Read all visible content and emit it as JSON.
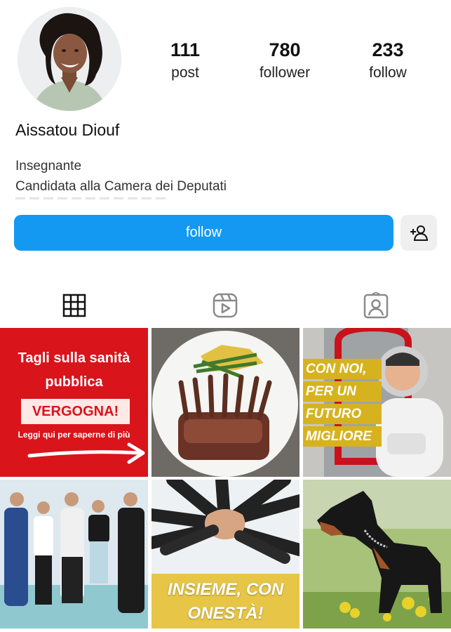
{
  "profile": {
    "name": "Aissatou Diouf",
    "bio_line1": "Insegnante",
    "bio_line2": "Candidata alla Camera dei Deputati"
  },
  "stats": {
    "posts": {
      "value": "111",
      "label": "post"
    },
    "followers": {
      "value": "780",
      "label": "follower"
    },
    "following": {
      "value": "233",
      "label": "follow"
    }
  },
  "actions": {
    "follow_label": "follow",
    "add_icon": "person-add-icon"
  },
  "tabs": [
    {
      "name": "grid",
      "icon": "grid-icon",
      "active": true
    },
    {
      "name": "reels",
      "icon": "reels-icon"
    },
    {
      "name": "tagged",
      "icon": "tagged-icon"
    }
  ],
  "posts": [
    {
      "type": "graphic",
      "line1": "Tagli sulla sanità",
      "line2": "pubblica",
      "highlight": "VERGOGNA!",
      "cta": "Leggi qui per saperne di più"
    },
    {
      "type": "photo",
      "subject": "food-plate"
    },
    {
      "type": "photo-with-text",
      "line1": "CON NOI,",
      "line2": "PER UN",
      "line3": "FUTURO",
      "line4": "MIGLIORE"
    },
    {
      "type": "photo",
      "subject": "business-team"
    },
    {
      "type": "photo-with-text",
      "line1": "INSIEME, CON",
      "line2": "ONESTÀ!"
    },
    {
      "type": "photo",
      "subject": "dog"
    }
  ],
  "colors": {
    "accent": "#1399f1",
    "post1_bg": "#d9141b",
    "banner_yellow": "#e6c547"
  }
}
